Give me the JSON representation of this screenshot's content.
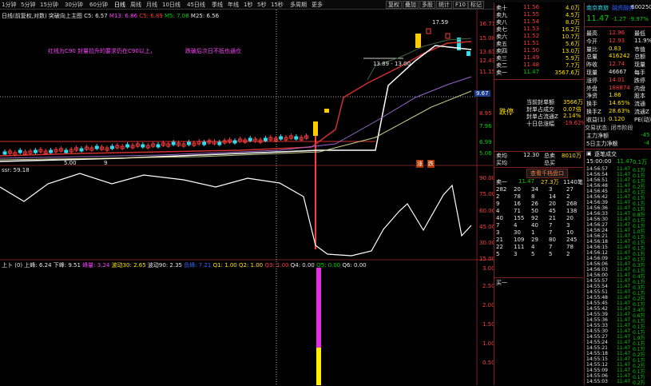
{
  "periods": [
    "1分钟",
    "5分钟",
    "15分钟",
    "30分钟",
    "60分钟",
    "日线",
    "周线",
    "月线",
    "10日线",
    "45日线",
    "季线",
    "年线",
    "1秒",
    "5秒",
    "15秒",
    "多周期",
    "更多"
  ],
  "top_buttons": [
    "复权",
    "叠加",
    "多股",
    "统计",
    "F10",
    "标记"
  ],
  "main_legend": {
    "mode": "日线(前复权,对数)",
    "formula": "突破向上主图",
    "c5": "C5: 6.57",
    "m13": "M13: 6.86",
    "c5b": "C5: 6.89",
    "m5": "M5: 7.08",
    "m25": "M25: 6.56"
  },
  "main_annotation_1": "红线为C90 封量拉升的要求仍在C90以上，",
  "main_annotation_2": "跌破后次日不抵也通仓",
  "chart_flags": {
    "peak": "17.59",
    "range": "13.89 - 13.00",
    "low": "5.00",
    "mark_left": "9",
    "mark_right_1": "涨",
    "mark_right_2": "跌"
  },
  "price_axis": [
    "16.71",
    "15.08",
    "13.61",
    "12.43",
    "11.15",
    "9.67",
    "8.95",
    "7.96",
    "6.99",
    "5.06"
  ],
  "price_current": "9.67",
  "osc_label": "ssr: 59.18",
  "osc_axis": [
    "90.00",
    "75.00",
    "60.00",
    "45.00",
    "30.00",
    "15.00"
  ],
  "bottom_legend": {
    "a": "上卜 (0) 上峰: 6.24",
    "b": "下峰: 9.51",
    "c": "峰量: 3.24",
    "d": "波动30: 2.65",
    "e": "波动90: 2.35",
    "f": "负峰: 7.21",
    "g": "Q1: 1.00",
    "h": "Q2: 1.00",
    "i": "Q3: 1.00",
    "j": "Q4: 0.00",
    "k": "Q5: 0.00",
    "l": "Q6: 0.00"
  },
  "bottom_axis": [
    "3.00",
    "2.50",
    "2.00",
    "1.50",
    "1.00",
    "0.50"
  ],
  "order_book": {
    "sells": [
      {
        "l": "卖十",
        "p": "11.56",
        "v": "4.0万"
      },
      {
        "l": "卖九",
        "p": "11.55",
        "v": "4.5万"
      },
      {
        "l": "卖八",
        "p": "11.54",
        "v": "8.0万"
      },
      {
        "l": "卖七",
        "p": "11.53",
        "v": "16.2万"
      },
      {
        "l": "卖六",
        "p": "11.52",
        "v": "10.7万"
      },
      {
        "l": "卖五",
        "p": "11.51",
        "v": "5.6万"
      },
      {
        "l": "卖四",
        "p": "11.50",
        "v": "13.0万"
      },
      {
        "l": "卖三",
        "p": "11.49",
        "v": "5.9万"
      },
      {
        "l": "卖二",
        "p": "11.48",
        "v": "7.7万"
      },
      {
        "l": "卖一",
        "p": "11.47",
        "v": "3567.6万"
      }
    ],
    "limit_down": "跌停",
    "stats": [
      {
        "k": "当前封单额",
        "v": "3566万"
      },
      {
        "k": "封单占成交",
        "v": "0.07倍"
      },
      {
        "k": "封单占流通Z",
        "v": "2.14%"
      },
      {
        "k": "十日总涨幅",
        "v": "-19.62%"
      }
    ],
    "avg_label": "卖均",
    "avg_val": "12.30",
    "total_sell_label": "总卖",
    "total_sell_val": "8010万",
    "buy_avg_label": "买均",
    "total_buy_label": "总买",
    "queue_btn": "查看千档盘口",
    "queue_head": {
      "l": "卖一",
      "p": "11.47",
      "n": "27.3万",
      "c": "1140笔"
    },
    "queue": [
      [
        "282",
        "20",
        "34",
        "3",
        "27"
      ],
      [
        "2",
        "78",
        "8",
        "14",
        "2"
      ],
      [
        "9",
        "16",
        "26",
        "20",
        "268"
      ],
      [
        "4",
        "71",
        "50",
        "45",
        "138"
      ],
      [
        "40",
        "155",
        "92",
        "21",
        "20"
      ],
      [
        "7",
        "4",
        "40",
        "7",
        "3"
      ],
      [
        "3",
        "30",
        "1",
        "7",
        "10"
      ],
      [
        "21",
        "109",
        "29",
        "80",
        "245"
      ],
      [
        "22",
        "111",
        "4",
        "7",
        "78"
      ],
      [
        "5",
        "3",
        "5",
        "5",
        "2"
      ]
    ],
    "buy_one": "买一"
  },
  "stock": {
    "name": "南京商旅",
    "tag": "融资融券",
    "code": "600250",
    "price": "11.47",
    "change": "-1.27",
    "pct": "-9.97%",
    "fields": [
      {
        "k": "最高",
        "v": "12.96",
        "k2": "最低",
        "v2": ""
      },
      {
        "k": "今开",
        "v": "12.93",
        "k2": "11.9%",
        "v2": ""
      },
      {
        "k": "量比",
        "v": "0.83",
        "k2": "市值",
        "v2": ""
      },
      {
        "k": "总量",
        "v": "416242",
        "k2": "总额",
        "v2": ""
      },
      {
        "k": "昨收",
        "v": "12.74",
        "k2": "现量",
        "v2": ""
      },
      {
        "k": "现量",
        "v": "46667",
        "k2": "每手",
        "v2": ""
      },
      {
        "k": "涨停",
        "v": "14.01",
        "k2": "跌停",
        "v2": ""
      },
      {
        "k": "外盘",
        "v": "188874",
        "k2": "内盘",
        "v2": ""
      },
      {
        "k": "净资",
        "v": "1.86",
        "k2": "股本",
        "v2": ""
      },
      {
        "k": "换手",
        "v": "14.65%",
        "k2": "流通",
        "v2": ""
      },
      {
        "k": "换手Z",
        "v": "28.63%",
        "k2": "流通Z",
        "v2": ""
      },
      {
        "k": "收益(1)",
        "v": "0.120",
        "k2": "PE(动)",
        "v2": ""
      }
    ],
    "status": "交易状态: 闭市阶段",
    "main_net": "主力净额",
    "main_net_v": "-45",
    "five_day": "5日主力净额",
    "five_day_v": "-4"
  },
  "ticks_header": "逐笔成交",
  "ticks_first": {
    "t": "15:00:00",
    "p": "11.47",
    "v": "0.1万"
  },
  "ticks": [
    {
      "t": "14:56:57",
      "p": "11.47",
      "v": "0.1万"
    },
    {
      "t": "14:56:54",
      "p": "11.47",
      "v": "0.1万"
    },
    {
      "t": "14:56:51",
      "p": "11.47",
      "v": "0.1万"
    },
    {
      "t": "14:56:48",
      "p": "11.47",
      "v": "0.2万"
    },
    {
      "t": "14:56:45",
      "p": "11.47",
      "v": "0.1万"
    },
    {
      "t": "14:56:42",
      "p": "11.47",
      "v": "0.1万"
    },
    {
      "t": "14:56:39",
      "p": "11.47",
      "v": "0.1万"
    },
    {
      "t": "14:56:36",
      "p": "11.47",
      "v": "0.1万"
    },
    {
      "t": "14:56:33",
      "p": "11.47",
      "v": "0.8万"
    },
    {
      "t": "14:56:30",
      "p": "11.47",
      "v": "0.1万"
    },
    {
      "t": "14:56:27",
      "p": "11.47",
      "v": "0.1万"
    },
    {
      "t": "14:56:24",
      "p": "11.47",
      "v": "1.0万"
    },
    {
      "t": "14:56:21",
      "p": "11.47",
      "v": "0.1万"
    },
    {
      "t": "14:56:18",
      "p": "11.47",
      "v": "0.1万"
    },
    {
      "t": "14:56:15",
      "p": "11.47",
      "v": "0.1万"
    },
    {
      "t": "14:56:12",
      "p": "11.47",
      "v": "0.1万"
    },
    {
      "t": "14:56:09",
      "p": "11.47",
      "v": "0.1万"
    },
    {
      "t": "14:56:06",
      "p": "11.47",
      "v": "0.3万"
    },
    {
      "t": "14:56:03",
      "p": "11.47",
      "v": "0.1万"
    },
    {
      "t": "14:56:00",
      "p": "11.47",
      "v": "0.4万"
    },
    {
      "t": "14:55:57",
      "p": "11.47",
      "v": "0.1万"
    },
    {
      "t": "14:55:54",
      "p": "11.47",
      "v": "0.3万"
    },
    {
      "t": "14:55:51",
      "p": "11.47",
      "v": "0.1万"
    },
    {
      "t": "14:55:48",
      "p": "11.47",
      "v": "0.2万"
    },
    {
      "t": "14:55:45",
      "p": "11.47",
      "v": "0.1万"
    },
    {
      "t": "14:55:42",
      "p": "11.47",
      "v": "3.4万"
    },
    {
      "t": "14:55:39",
      "p": "11.47",
      "v": "0.6万"
    },
    {
      "t": "14:55:36",
      "p": "11.47",
      "v": "0.1万"
    },
    {
      "t": "14:55:33",
      "p": "11.47",
      "v": "0.1万"
    },
    {
      "t": "14:55:30",
      "p": "11.47",
      "v": "0.1万"
    },
    {
      "t": "14:55:27",
      "p": "11.47",
      "v": "1.9万"
    },
    {
      "t": "14:55:24",
      "p": "11.47",
      "v": "0.1万"
    },
    {
      "t": "14:55:21",
      "p": "11.47",
      "v": "0.1万"
    },
    {
      "t": "14:55:18",
      "p": "11.47",
      "v": "0.2万"
    },
    {
      "t": "14:55:15",
      "p": "11.47",
      "v": "0.1万"
    },
    {
      "t": "14:55:12",
      "p": "11.47",
      "v": "0.2万"
    },
    {
      "t": "14:55:09",
      "p": "11.47",
      "v": "0.1万"
    },
    {
      "t": "14:55:06",
      "p": "11.47",
      "v": "0.1万"
    },
    {
      "t": "14:55:03",
      "p": "11.47",
      "v": "0.2万"
    },
    {
      "t": "14:55:00",
      "p": "11.47",
      "v": "0.6万"
    }
  ],
  "colors": {
    "up": "#ff3b3b",
    "down": "#00d000",
    "yellow": "#ffe000",
    "magenta": "#ff40ff",
    "cyan": "#33ddee",
    "frame": "#7a2222"
  }
}
